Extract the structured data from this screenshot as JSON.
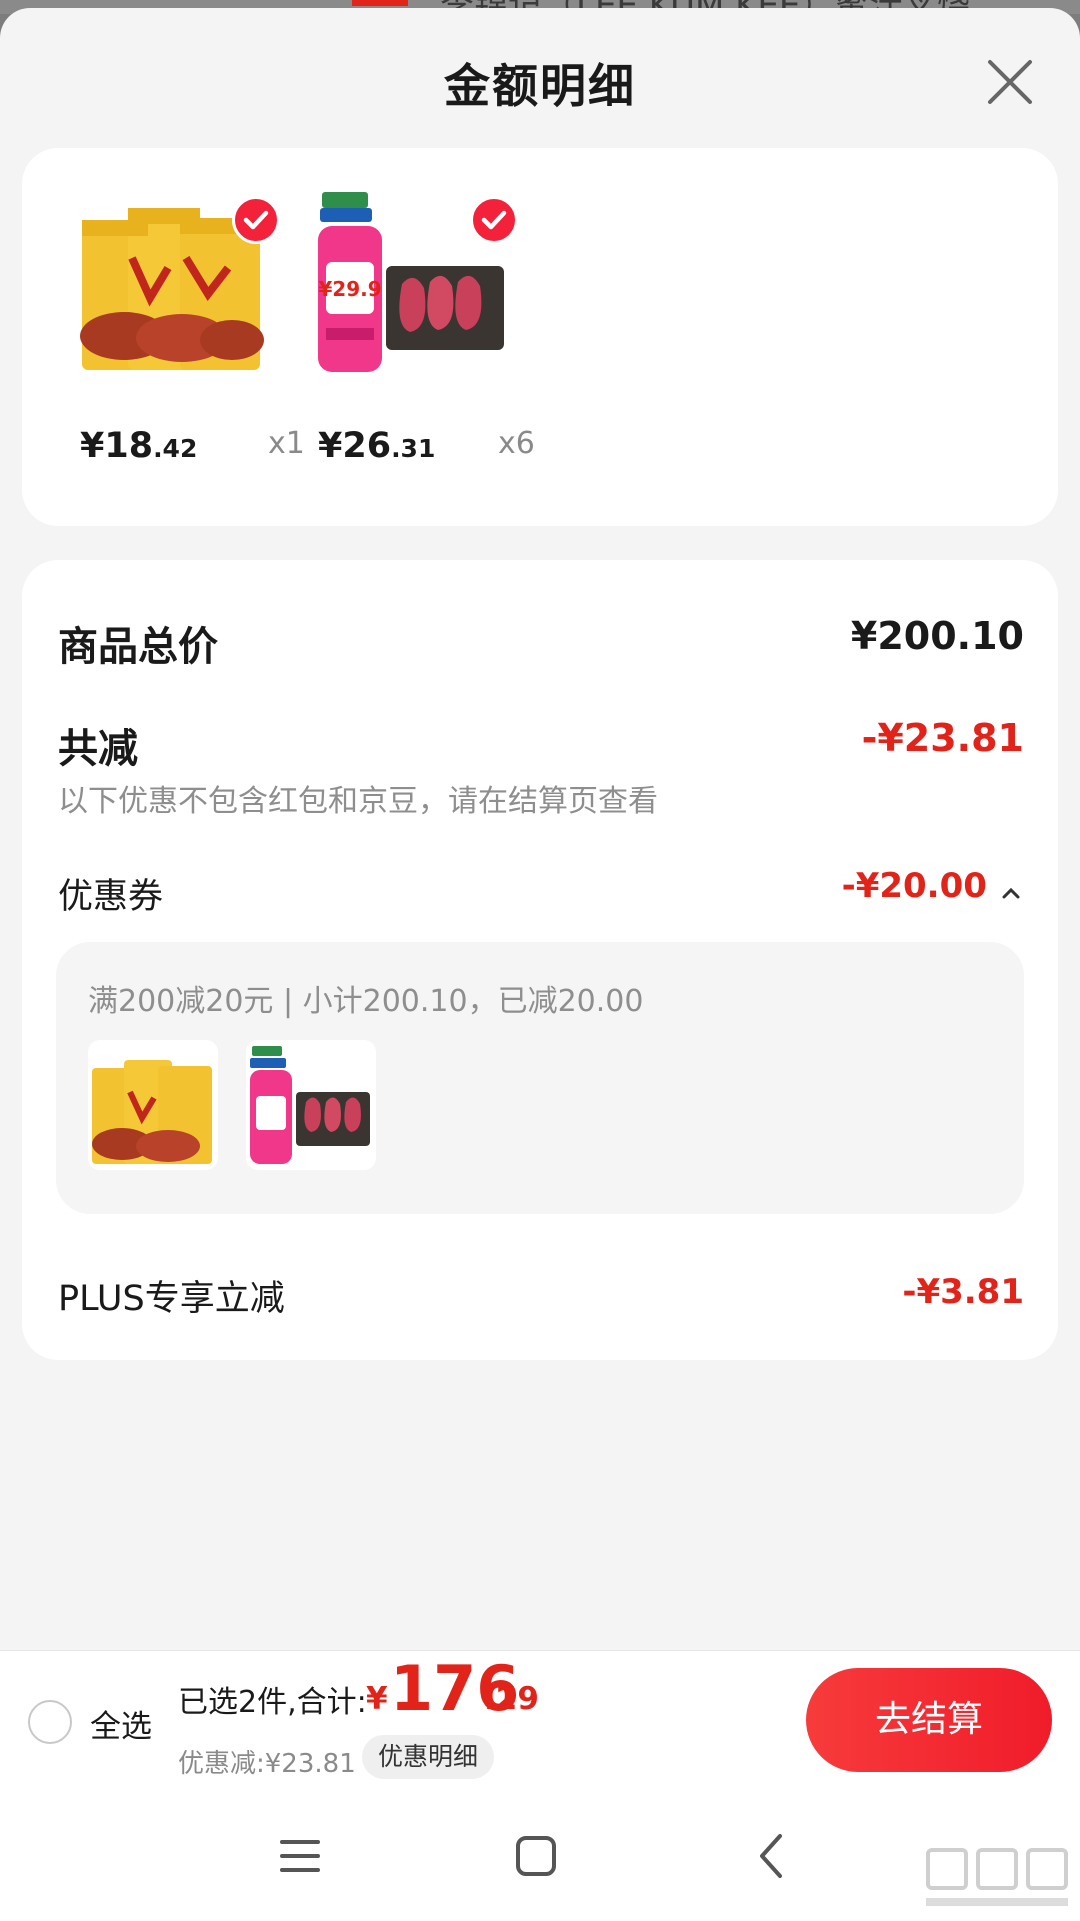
{
  "background_text": "李锦记（LEE KUM KEE）蜜汁叉烧",
  "sheet": {
    "title": "金额明细",
    "close_icon": "close-icon"
  },
  "products": [
    {
      "price_int": "¥18",
      "price_dec": ".42",
      "qty": "x1",
      "checked": true,
      "image": "char-siu-sauce-packets"
    },
    {
      "price_int": "¥26",
      "price_dec": ".31",
      "qty": "x6",
      "checked": true,
      "image": "lamb-chops-promo",
      "image_text": "¥29.9"
    }
  ],
  "summary": {
    "total_label": "商品总价",
    "total_value": "¥200.10",
    "reduce_label": "共减",
    "reduce_value": "-¥23.81",
    "note": "以下优惠不包含红包和京豆，请在结算页查看",
    "coupon_label": "优惠券",
    "coupon_value": "-¥20.00",
    "coupon_desc": "满200减20元 | 小计200.10，已减20.00",
    "plus_label": "PLUS专享立减",
    "plus_value": "-¥3.81"
  },
  "bottom": {
    "select_all": "全选",
    "selected_count": "已选2件,合计:",
    "currency": "¥",
    "total_int": "176",
    "total_dec": ".29",
    "discount": "优惠减:¥23.81",
    "detail_chip": "优惠明细",
    "checkout": "去结算"
  },
  "nav": {
    "menu_icon": "menu-icon",
    "home_icon": "home-icon",
    "back_icon": "back-icon"
  },
  "colors": {
    "accent_red": "#e2231a",
    "button_red": "#f01c2a"
  }
}
